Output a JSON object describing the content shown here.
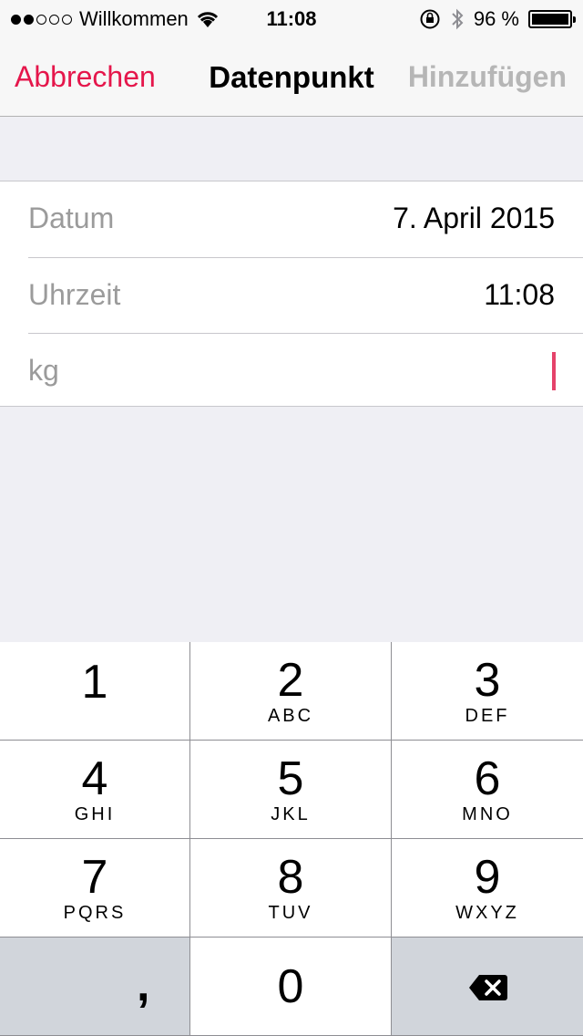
{
  "status_bar": {
    "signal_dots": [
      true,
      true,
      false,
      false,
      false
    ],
    "carrier": "Willkommen",
    "time": "11:08",
    "battery_percent": "96 %",
    "icons": [
      "wifi-icon",
      "orientation-lock-icon",
      "bluetooth-icon",
      "battery-icon"
    ]
  },
  "nav": {
    "cancel_label": "Abbrechen",
    "title": "Datenpunkt",
    "add_label": "Hinzufügen"
  },
  "form": {
    "rows": [
      {
        "label": "Datum",
        "value": "7. April 2015"
      },
      {
        "label": "Uhrzeit",
        "value": "11:08"
      },
      {
        "label": "kg",
        "value": ""
      }
    ]
  },
  "keypad": {
    "keys": [
      {
        "number": "1",
        "letters": ""
      },
      {
        "number": "2",
        "letters": "ABC"
      },
      {
        "number": "3",
        "letters": "DEF"
      },
      {
        "number": "4",
        "letters": "GHI"
      },
      {
        "number": "5",
        "letters": "JKL"
      },
      {
        "number": "6",
        "letters": "MNO"
      },
      {
        "number": "7",
        "letters": "PQRS"
      },
      {
        "number": "8",
        "letters": "TUV"
      },
      {
        "number": "9",
        "letters": "WXYZ"
      }
    ],
    "comma_label": ",",
    "zero_label": "0",
    "delete_icon": "backspace-icon"
  },
  "colors": {
    "accent": "#e5164b",
    "disabled": "#b6b6b6",
    "cursor": "#e5426a",
    "background": "#efeff4"
  }
}
